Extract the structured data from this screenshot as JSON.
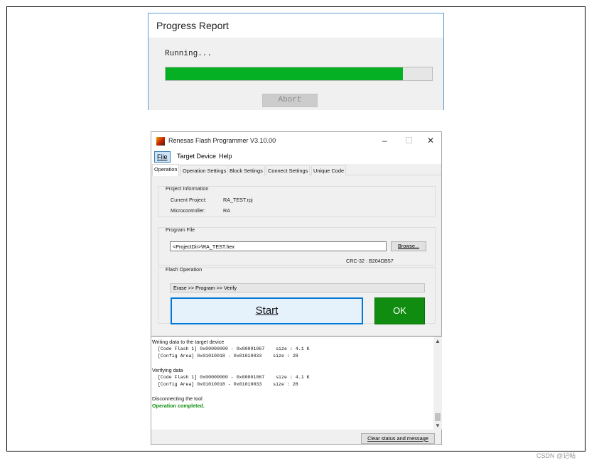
{
  "progress_dialog": {
    "title": "Progress Report",
    "status": "Running...",
    "progress_fraction": 0.89,
    "progress_color": "#06b025",
    "abort_label": "Abort"
  },
  "main_window": {
    "title": "Renesas Flash Programmer V3.10.00",
    "controls": {
      "minimize": "–",
      "maximize": "☐",
      "close": "✕"
    },
    "menu": {
      "file": "File",
      "target_device": "Target Device",
      "help": "Help"
    },
    "tabs": [
      "Operation",
      "Operation Settings",
      "Block Settings",
      "Connect Settings",
      "Unique Code"
    ],
    "active_tab": "Operation",
    "project_info": {
      "title": "Project Information",
      "current_project_label": "Current Project:",
      "current_project_value": "RA_TEST.rpj",
      "microcontroller_label": "Microcontroller:",
      "microcontroller_value": "RA"
    },
    "program_file": {
      "title": "Program File",
      "path_value": "<ProjectDir>\\RA_TEST.hex",
      "browse_label": "Browse...",
      "crc": "CRC-32 : B204DB57"
    },
    "flash_operation": {
      "title": "Flash Operation",
      "sequence": "Erase >> Program >> Verify",
      "start_label": "Start",
      "result_label": "OK",
      "result_color": "#108c10"
    },
    "log": {
      "lines": [
        "Writing data to the target device",
        "  [Code Flash 1] 0x00000000 - 0x00001067    size : 4.1 K",
        "  [Config Area] 0x01010018 - 0x01010033    size : 28",
        "",
        "Verifying data",
        "  [Code Flash 1] 0x00000000 - 0x00001067    size : 4.1 K",
        "  [Config Area] 0x01010018 - 0x01010033    size : 28",
        "",
        "Disconnecting the tool"
      ],
      "completed": "Operation completed."
    },
    "clear_label": "Clear status and message"
  },
  "watermark": "CSDN @记帖"
}
